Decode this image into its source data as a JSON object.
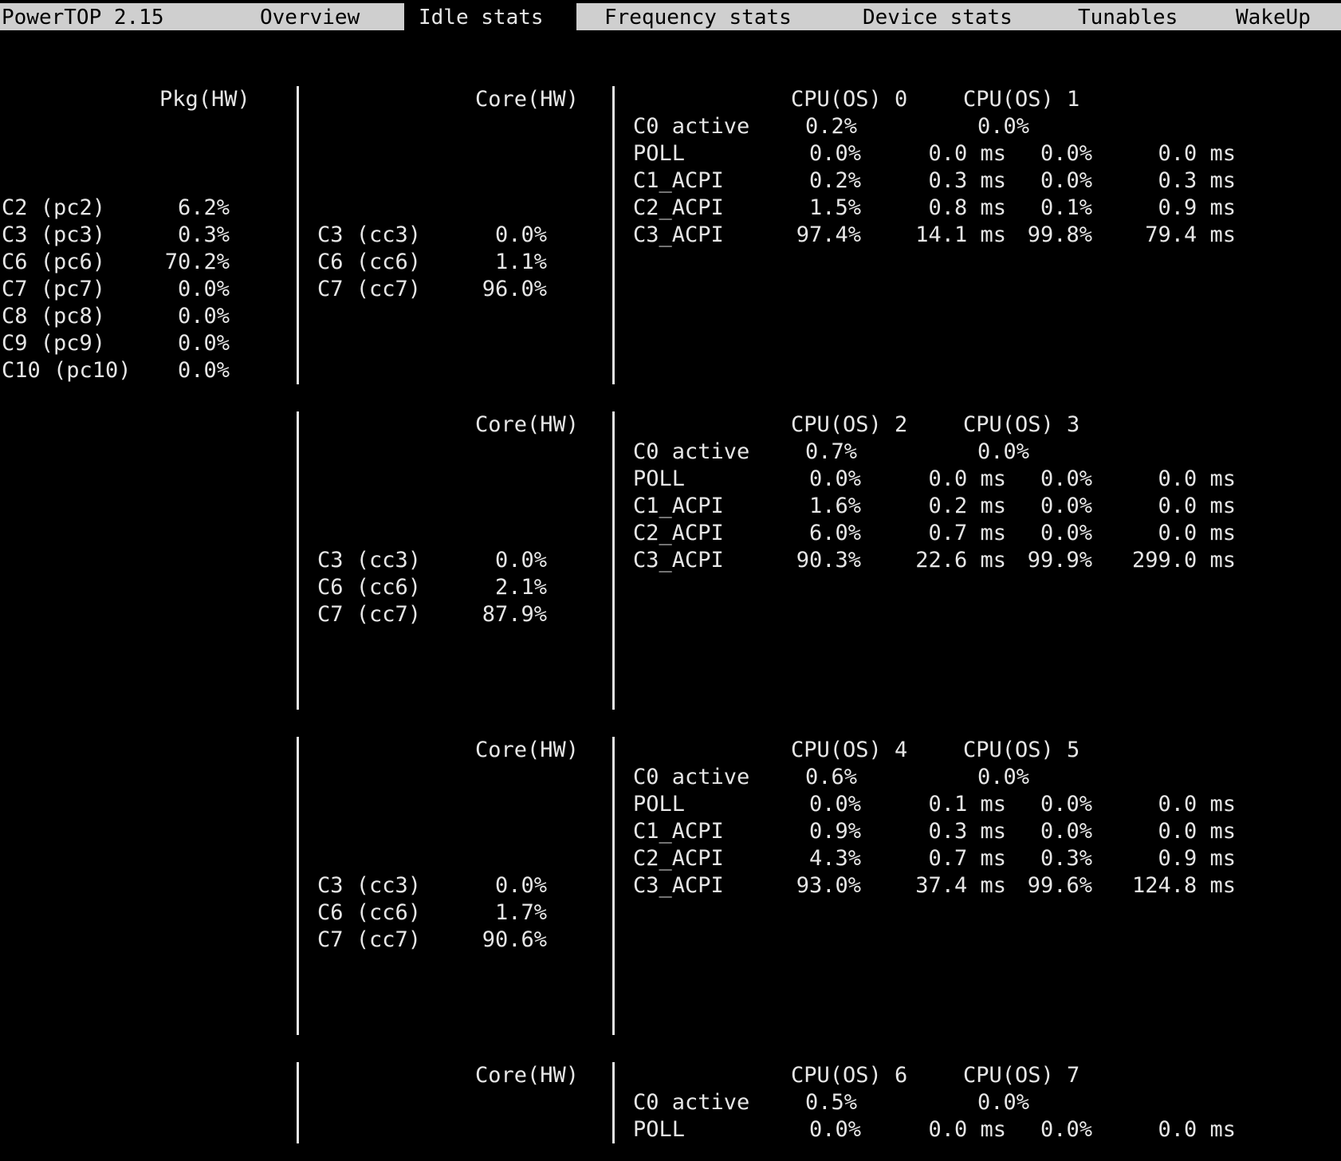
{
  "tabs": [
    {
      "label": "PowerTOP 2.15",
      "selected": false
    },
    {
      "label": "Overview",
      "selected": false
    },
    {
      "label": "Idle stats",
      "selected": true
    },
    {
      "label": "Frequency stats",
      "selected": false
    },
    {
      "label": "Device stats",
      "selected": false
    },
    {
      "label": "Tunables",
      "selected": false
    },
    {
      "label": "WakeUp",
      "selected": false
    }
  ],
  "package": {
    "header": "Pkg(HW)",
    "states": [
      {
        "name": "C2 (pc2)",
        "value": "6.2%"
      },
      {
        "name": "C3 (pc3)",
        "value": "0.3%"
      },
      {
        "name": "C6 (pc6)",
        "value": "70.2%"
      },
      {
        "name": "C7 (pc7)",
        "value": "0.0%"
      },
      {
        "name": "C8 (pc8)",
        "value": "0.0%"
      },
      {
        "name": "C9 (pc9)",
        "value": "0.0%"
      },
      {
        "name": "C10 (pc10)",
        "value": "0.0%"
      }
    ]
  },
  "cores": [
    {
      "header": "Core(HW)",
      "states": [
        {
          "name": "C3 (cc3)",
          "value": "0.0%"
        },
        {
          "name": "C6 (cc6)",
          "value": "1.1%"
        },
        {
          "name": "C7 (cc7)",
          "value": "96.0%"
        }
      ],
      "cpu_a": "CPU(OS) 0",
      "cpu_b": "CPU(OS) 1",
      "active_a": "0.2%",
      "active_b": "0.0%",
      "rows": [
        {
          "name": "POLL",
          "pa": "0.0%",
          "ta": "0.0 ms",
          "pb": "0.0%",
          "tb": "0.0 ms"
        },
        {
          "name": "C1_ACPI",
          "pa": "0.2%",
          "ta": "0.3 ms",
          "pb": "0.0%",
          "tb": "0.3 ms"
        },
        {
          "name": "C2_ACPI",
          "pa": "1.5%",
          "ta": "0.8 ms",
          "pb": "0.1%",
          "tb": "0.9 ms"
        },
        {
          "name": "C3_ACPI",
          "pa": "97.4%",
          "ta": "14.1 ms",
          "pb": "99.8%",
          "tb": "79.4 ms"
        }
      ]
    },
    {
      "header": "Core(HW)",
      "states": [
        {
          "name": "C3 (cc3)",
          "value": "0.0%"
        },
        {
          "name": "C6 (cc6)",
          "value": "2.1%"
        },
        {
          "name": "C7 (cc7)",
          "value": "87.9%"
        }
      ],
      "cpu_a": "CPU(OS) 2",
      "cpu_b": "CPU(OS) 3",
      "active_a": "0.7%",
      "active_b": "0.0%",
      "rows": [
        {
          "name": "POLL",
          "pa": "0.0%",
          "ta": "0.0 ms",
          "pb": "0.0%",
          "tb": "0.0 ms"
        },
        {
          "name": "C1_ACPI",
          "pa": "1.6%",
          "ta": "0.2 ms",
          "pb": "0.0%",
          "tb": "0.0 ms"
        },
        {
          "name": "C2_ACPI",
          "pa": "6.0%",
          "ta": "0.7 ms",
          "pb": "0.0%",
          "tb": "0.0 ms"
        },
        {
          "name": "C3_ACPI",
          "pa": "90.3%",
          "ta": "22.6 ms",
          "pb": "99.9%",
          "tb": "299.0 ms"
        }
      ]
    },
    {
      "header": "Core(HW)",
      "states": [
        {
          "name": "C3 (cc3)",
          "value": "0.0%"
        },
        {
          "name": "C6 (cc6)",
          "value": "1.7%"
        },
        {
          "name": "C7 (cc7)",
          "value": "90.6%"
        }
      ],
      "cpu_a": "CPU(OS) 4",
      "cpu_b": "CPU(OS) 5",
      "active_a": "0.6%",
      "active_b": "0.0%",
      "rows": [
        {
          "name": "POLL",
          "pa": "0.0%",
          "ta": "0.1 ms",
          "pb": "0.0%",
          "tb": "0.0 ms"
        },
        {
          "name": "C1_ACPI",
          "pa": "0.9%",
          "ta": "0.3 ms",
          "pb": "0.0%",
          "tb": "0.0 ms"
        },
        {
          "name": "C2_ACPI",
          "pa": "4.3%",
          "ta": "0.7 ms",
          "pb": "0.3%",
          "tb": "0.9 ms"
        },
        {
          "name": "C3_ACPI",
          "pa": "93.0%",
          "ta": "37.4 ms",
          "pb": "99.6%",
          "tb": "124.8 ms"
        }
      ]
    },
    {
      "header": "Core(HW)",
      "states": [],
      "cpu_a": "CPU(OS) 6",
      "cpu_b": "CPU(OS) 7",
      "active_a": "0.5%",
      "active_b": "0.0%",
      "rows": [
        {
          "name": "POLL",
          "pa": "0.0%",
          "ta": "0.0 ms",
          "pb": "0.0%",
          "tb": "0.0 ms"
        }
      ]
    }
  ],
  "labels": {
    "c0_active": "C0 active"
  }
}
